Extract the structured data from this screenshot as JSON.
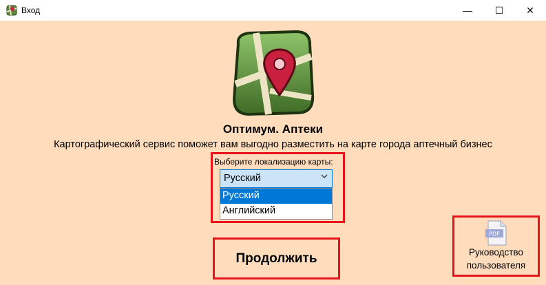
{
  "window": {
    "title": "Вход",
    "minimize_glyph": "—",
    "maximize_glyph": "☐",
    "close_glyph": "✕"
  },
  "app": {
    "title": "Оптимум. Аптеки",
    "subtitle": "Картографический сервис поможет вам выгодно разместить на карте города аптечный бизнес"
  },
  "locale": {
    "label": "Выберите локализацию карты:",
    "selected": "Русский",
    "options": [
      "Русский",
      "Английский"
    ]
  },
  "buttons": {
    "continue": "Продолжить",
    "guide_line1": "Руководство",
    "guide_line2": "пользователя",
    "pdf_badge": "PDF"
  },
  "colors": {
    "background": "#fedcbc",
    "highlight": "#e8141b",
    "selection": "#0078d7"
  },
  "icons": {
    "app": "map-icon",
    "logo": "map-pin-icon",
    "combo": "chevron-down-icon",
    "guide": "pdf-icon"
  }
}
